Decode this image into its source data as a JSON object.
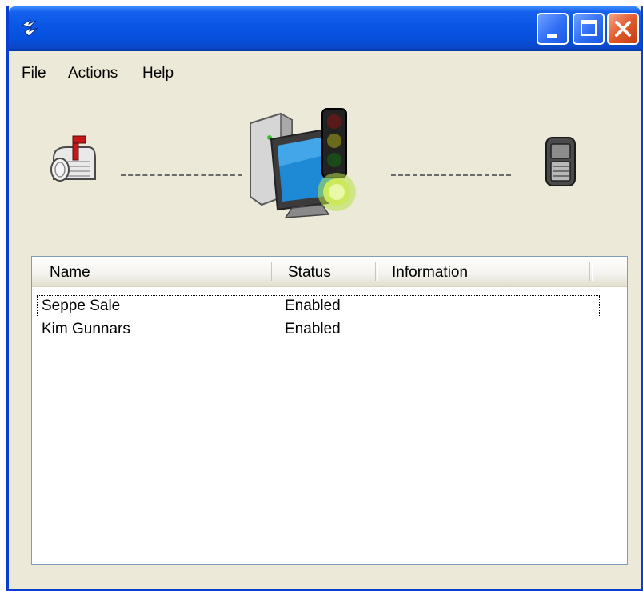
{
  "window": {
    "app_icon": "app-logo-icon",
    "controls": [
      "minimize-icon",
      "maximize-icon",
      "close-icon"
    ]
  },
  "menu": {
    "items": [
      "File",
      "Actions",
      "Help"
    ]
  },
  "status_illustration": {
    "left_icon": "mailbox-icon",
    "center_icon": "computer-traffic-light-icon",
    "right_icon": "mobile-device-icon",
    "connection_style": "dashed",
    "traffic_light_state": "green"
  },
  "list": {
    "columns": [
      "Name",
      "Status",
      "Information"
    ],
    "rows": [
      {
        "name": "Seppe Sale",
        "status": "Enabled",
        "information": ""
      },
      {
        "name": "Kim Gunnars",
        "status": "Enabled",
        "information": ""
      }
    ]
  },
  "colors": {
    "titlebar": "#0a56e6",
    "window_bg": "#ece9d8",
    "close_button": "#e25a2c",
    "list_bg": "#ffffff"
  }
}
